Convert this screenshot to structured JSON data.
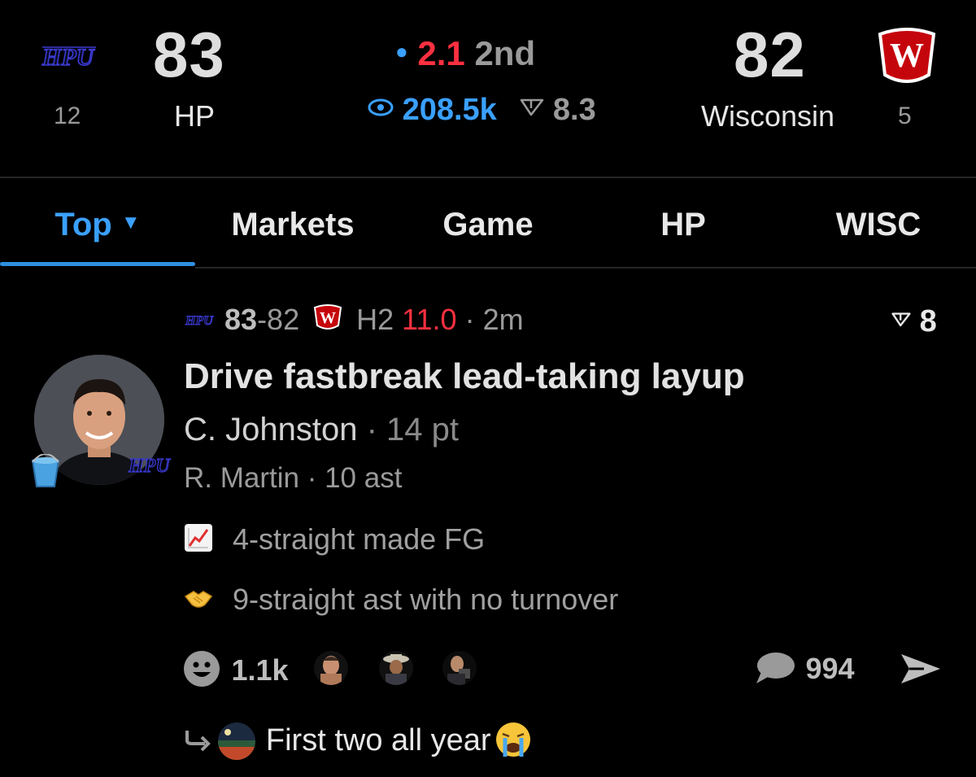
{
  "header": {
    "home": {
      "logo_text": "HPU",
      "score": "83",
      "name": "HP",
      "rank": "12"
    },
    "away": {
      "logo_text": "W",
      "score": "82",
      "name": "Wisconsin",
      "rank": "5"
    },
    "clock": {
      "time": "2.1",
      "period": "2nd"
    },
    "viewers": "208.5k",
    "rating": "8.3"
  },
  "tabs": [
    {
      "label": "Top"
    },
    {
      "label": "Markets"
    },
    {
      "label": "Game"
    },
    {
      "label": "HP"
    },
    {
      "label": "WISC"
    }
  ],
  "post": {
    "meta": {
      "home_score": "83",
      "away_score": "-82",
      "half": "H2",
      "time_left": "11.0",
      "age": "2m",
      "rating": "8"
    },
    "headline": "Drive fastbreak lead-taking layup",
    "player": "C. Johnston",
    "player_stat": "14 pt",
    "assist_player": "R. Martin",
    "assist_stat": "10 ast",
    "streaks": [
      {
        "icon": "chart-increasing-icon",
        "text": "4-straight made FG"
      },
      {
        "icon": "handshake-icon",
        "text": "9-straight ast with no turnover"
      }
    ],
    "reactions_count": "1.1k",
    "comments_count": "994",
    "reply": {
      "text": "First two all year"
    }
  },
  "colors": {
    "accent": "#3aa0ff",
    "live_red": "#ff3040",
    "background": "#000000"
  }
}
